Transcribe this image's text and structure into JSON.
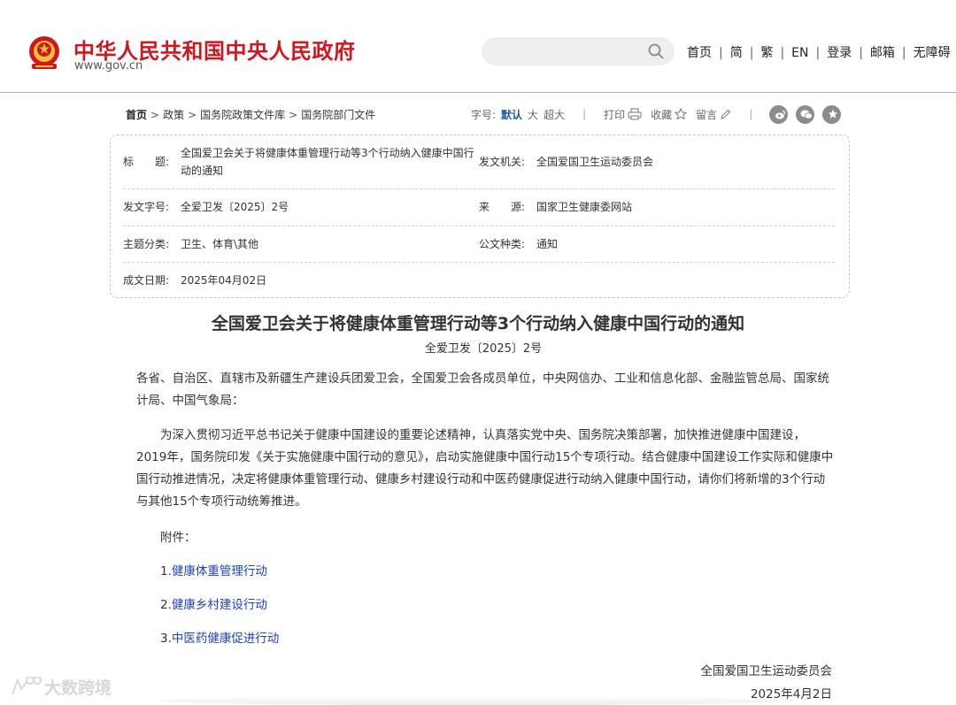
{
  "header": {
    "site_title": "中华人民共和国中央人民政府",
    "site_url": "www.gov.cn",
    "search_placeholder": "",
    "nav": [
      "首页",
      "简",
      "繁",
      "EN",
      "登录",
      "邮箱",
      "无障碍"
    ]
  },
  "breadcrumb": [
    "首页",
    "政策",
    "国务院政策文件库",
    "国务院部门文件"
  ],
  "tools": {
    "font_size_label": "字号:",
    "font_sizes": [
      "默认",
      "大",
      "超大"
    ],
    "print": "打印",
    "favorite": "收藏",
    "comment": "留言"
  },
  "meta": {
    "title_label": "标　　题:",
    "title_value": "全国爱卫会关于将健康体重管理行动等3个行动纳入健康中国行动的通知",
    "issuer_label": "发文机关:",
    "issuer_value": "全国爱国卫生运动委员会",
    "docno_label": "发文字号:",
    "docno_value": "全爱卫发〔2025〕2号",
    "source_label": "来　　源:",
    "source_value": "国家卫生健康委网站",
    "topic_label": "主题分类:",
    "topic_value": "卫生、体育\\其他",
    "type_label": "公文种类:",
    "type_value": "通知",
    "date_label": "成文日期:",
    "date_value": "2025年04月02日"
  },
  "article": {
    "title": "全国爱卫会关于将健康体重管理行动等3个行动纳入健康中国行动的通知",
    "doc_no": "全爱卫发〔2025〕2号",
    "addressee": "各省、自治区、直辖市及新疆生产建设兵团爱卫会，全国爱卫会各成员单位，中央网信办、工业和信息化部、金融监管总局、国家统计局、中国气象局：",
    "body": "为深入贯彻习近平总书记关于健康中国建设的重要论述精神，认真落实党中央、国务院决策部署，加快推进健康中国建设，2019年，国务院印发《关于实施健康中国行动的意见》，启动实施健康中国行动15个专项行动。结合健康中国建设工作实际和健康中国行动推进情况，决定将健康体重管理行动、健康乡村建设行动和中医药健康促进行动纳入健康中国行动，请你们将新增的3个行动与其他15个专项行动统筹推进。",
    "attachments_label": "附件：",
    "attachments": [
      {
        "num": "1.",
        "title": "健康体重管理行动"
      },
      {
        "num": "2.",
        "title": "健康乡村建设行动"
      },
      {
        "num": "3.",
        "title": "中医药健康促进行动"
      }
    ],
    "signature": "全国爱国卫生运动委员会",
    "sign_date": "2025年4月2日"
  },
  "watermark": "大数跨境",
  "colors": {
    "title_red": "#d0171f",
    "link_blue": "#1d3fcc",
    "active_blue": "#1d5cb5"
  }
}
